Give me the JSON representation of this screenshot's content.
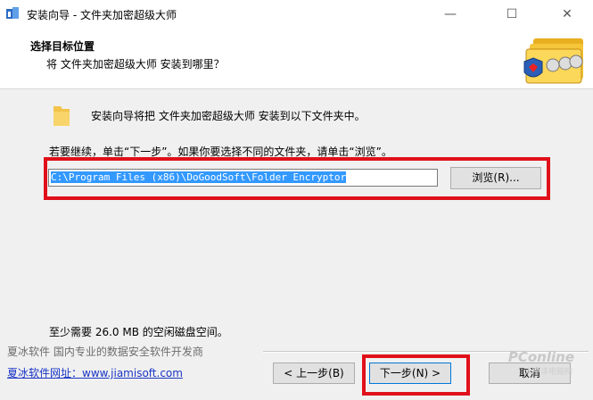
{
  "window": {
    "title": "安装向导 - 文件夹加密超级大师",
    "minimize": "—",
    "maximize": "☐",
    "close": "✕"
  },
  "header": {
    "title": "选择目标位置",
    "subtitle": "将 文件夹加密超级大师 安装到哪里？"
  },
  "main": {
    "intro": "安装向导将把 文件夹加密超级大师 安装到以下文件夹中。",
    "hint": "若要继续，单击“下一步”。如果你要选择不同的文件夹，请单击“浏览”。",
    "install_path": "C:\\Program Files (x86)\\DoGoodSoft\\Folder Encryptor",
    "browse_label": "浏览(R)...",
    "disk_space": "至少需要 26.0 MB 的空闲磁盘空间。"
  },
  "footer": {
    "company": "夏冰软件 国内专业的数据安全软件开发商",
    "website": "夏冰软件网址：www.jiamisoft.com",
    "back_label": "< 上一步(B)",
    "next_label": "下一步(N) >",
    "cancel_label": "取消"
  },
  "watermark": {
    "brand": "PConline",
    "sub": "太平洋电脑网"
  },
  "colors": {
    "highlight": "#e0101a",
    "selection": "#3399ff",
    "link": "#1a35c6"
  }
}
